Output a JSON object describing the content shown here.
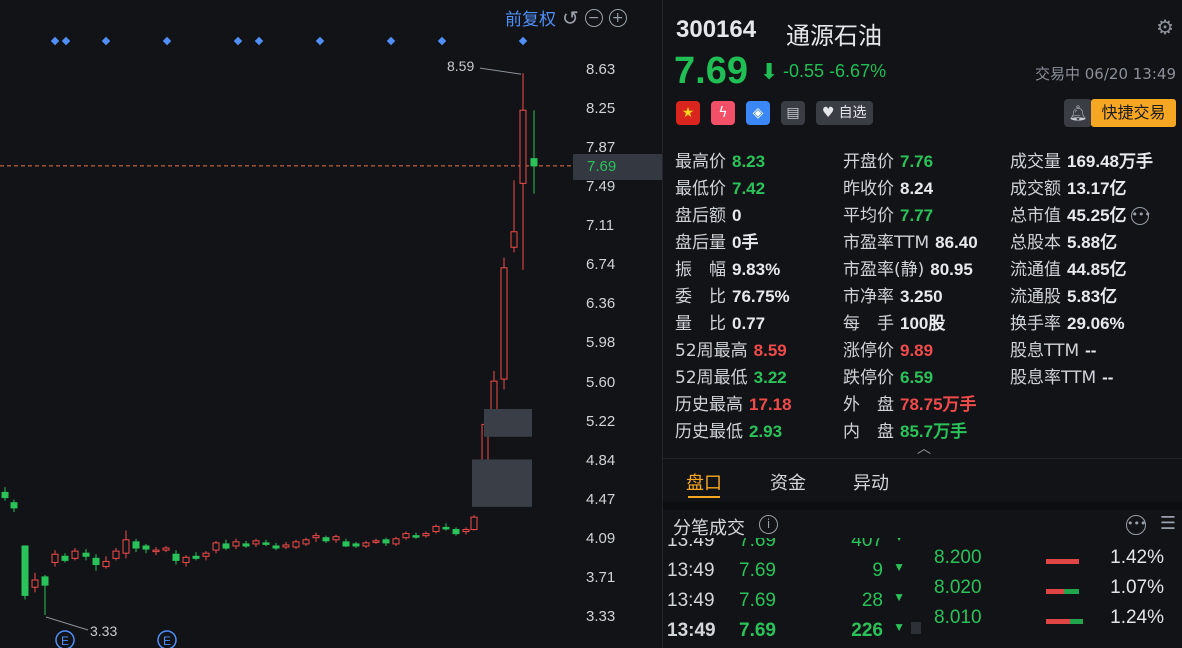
{
  "chart": {
    "toolbar": {
      "adjust_label": "前复权"
    },
    "axis_ticks": [
      "8.63",
      "8.25",
      "7.87",
      "7.49",
      "7.11",
      "6.74",
      "6.36",
      "5.98",
      "5.60",
      "5.22",
      "4.84",
      "4.47",
      "4.09",
      "3.71",
      "3.33"
    ],
    "current_price": "7.69",
    "high_label": "8.59",
    "low_label": "3.33",
    "event_marker": "E"
  },
  "stock": {
    "code": "300164",
    "name": "通源石油",
    "price": "7.69",
    "change": "-0.55",
    "change_pct": "-6.67%",
    "status": "交易中 06/20 13:49",
    "watch_label": "自选",
    "quick_trade_label": "快捷交易"
  },
  "stats": {
    "col1": [
      {
        "label": "最高价",
        "value": "8.23",
        "color": "green"
      },
      {
        "label": "最低价",
        "value": "7.42",
        "color": "green"
      },
      {
        "label": "盘后额",
        "value": "0",
        "color": "white"
      },
      {
        "label": "盘后量",
        "value": "0手",
        "color": "white"
      },
      {
        "label": "振　幅",
        "value": "9.83%",
        "color": "white"
      },
      {
        "label": "委　比",
        "value": "76.75%",
        "color": "white"
      },
      {
        "label": "量　比",
        "value": "0.77",
        "color": "white"
      },
      {
        "label": "52周最高",
        "value": "8.59",
        "color": "red"
      },
      {
        "label": "52周最低",
        "value": "3.22",
        "color": "green"
      },
      {
        "label": "历史最高",
        "value": "17.18",
        "color": "red"
      },
      {
        "label": "历史最低",
        "value": "2.93",
        "color": "green"
      }
    ],
    "col2": [
      {
        "label": "开盘价",
        "value": "7.76",
        "color": "green"
      },
      {
        "label": "昨收价",
        "value": "8.24",
        "color": "white"
      },
      {
        "label": "平均价",
        "value": "7.77",
        "color": "green"
      },
      {
        "label": "市盈率TTM",
        "value": "86.40",
        "color": "white"
      },
      {
        "label": "市盈率(静)",
        "value": "80.95",
        "color": "white"
      },
      {
        "label": "市净率",
        "value": "3.250",
        "color": "white"
      },
      {
        "label": "每　手",
        "value": "100股",
        "color": "white"
      },
      {
        "label": "涨停价",
        "value": "9.89",
        "color": "red"
      },
      {
        "label": "跌停价",
        "value": "6.59",
        "color": "green"
      },
      {
        "label": "外　盘",
        "value": "78.75万手",
        "color": "red"
      },
      {
        "label": "内　盘",
        "value": "85.7万手",
        "color": "green"
      }
    ],
    "col3": [
      {
        "label": "成交量",
        "value": "169.48万手",
        "color": "white"
      },
      {
        "label": "成交额",
        "value": "13.17亿",
        "color": "white"
      },
      {
        "label": "总市值",
        "value": "45.25亿",
        "color": "white"
      },
      {
        "label": "总股本",
        "value": "5.88亿",
        "color": "white"
      },
      {
        "label": "流通值",
        "value": "44.85亿",
        "color": "white"
      },
      {
        "label": "流通股",
        "value": "5.83亿",
        "color": "white"
      },
      {
        "label": "换手率",
        "value": "29.06%",
        "color": "white"
      },
      {
        "label": "股息TTM",
        "value": "--",
        "color": "white"
      },
      {
        "label": "股息率TTM",
        "value": "--",
        "color": "white"
      }
    ]
  },
  "tabs": [
    "盘口",
    "资金",
    "异动"
  ],
  "section_title": "分笔成交",
  "trades": [
    {
      "time": "13:49",
      "price": "7.69",
      "vol": "407"
    },
    {
      "time": "13:49",
      "price": "7.69",
      "vol": "9"
    },
    {
      "time": "13:49",
      "price": "7.69",
      "vol": "28"
    },
    {
      "time": "13:49",
      "price": "7.69",
      "vol": "226"
    }
  ],
  "depth": [
    {
      "price": "8.200",
      "pct": "1.42%",
      "red": 0.75,
      "green": 0.0
    },
    {
      "price": "8.020",
      "pct": "1.07%",
      "red": 0.4,
      "green": 0.35
    },
    {
      "price": "8.010",
      "pct": "1.24%",
      "red": 0.55,
      "green": 0.3
    }
  ],
  "colors": {
    "up": "#f04b4b",
    "down": "#2ac35a",
    "accent": "#f5a623",
    "link": "#4f8ff7"
  }
}
